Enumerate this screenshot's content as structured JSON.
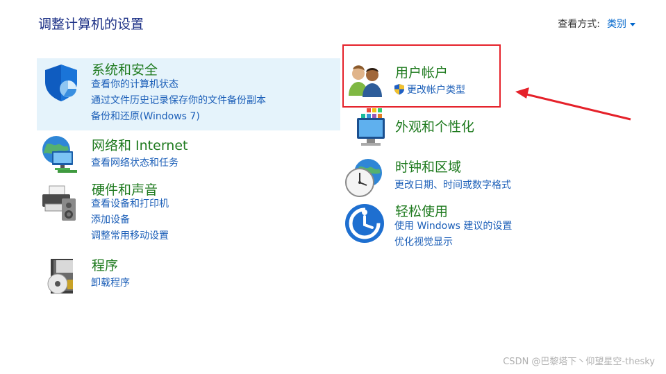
{
  "header": {
    "title": "调整计算机的设置",
    "view_by_label": "查看方式:",
    "view_by_value": "类别"
  },
  "categories": [
    {
      "title": "系统和安全",
      "icon": "shield-icon",
      "links": [
        "查看你的计算机状态",
        "通过文件历史记录保存你的文件备份副本",
        "备份和还原(Windows 7)"
      ]
    },
    {
      "title": "网络和 Internet",
      "icon": "network-globe-icon",
      "links": [
        "查看网络状态和任务"
      ]
    },
    {
      "title": "硬件和声音",
      "icon": "printer-speaker-icon",
      "links": [
        "查看设备和打印机",
        "添加设备",
        "调整常用移动设置"
      ]
    },
    {
      "title": "程序",
      "icon": "programs-disc-icon",
      "links": [
        "卸载程序"
      ]
    },
    {
      "title": "用户帐户",
      "icon": "users-icon",
      "links": [
        "更改帐户类型"
      ]
    },
    {
      "title": "外观和个性化",
      "icon": "monitor-tiles-icon",
      "links": []
    },
    {
      "title": "时钟和区域",
      "icon": "clock-globe-icon",
      "links": [
        "更改日期、时间或数字格式"
      ]
    },
    {
      "title": "轻松使用",
      "icon": "ease-of-access-icon",
      "links": [
        "使用 Windows 建议的设置",
        "优化视觉显示"
      ]
    }
  ],
  "watermark": "CSDN @巴黎塔下丶仰望星空-thesky",
  "colors": {
    "category_title": "#1e7a1e",
    "link": "#1c5fb8",
    "highlight": "#e5f3fb",
    "annotation_red": "#e5212a"
  }
}
